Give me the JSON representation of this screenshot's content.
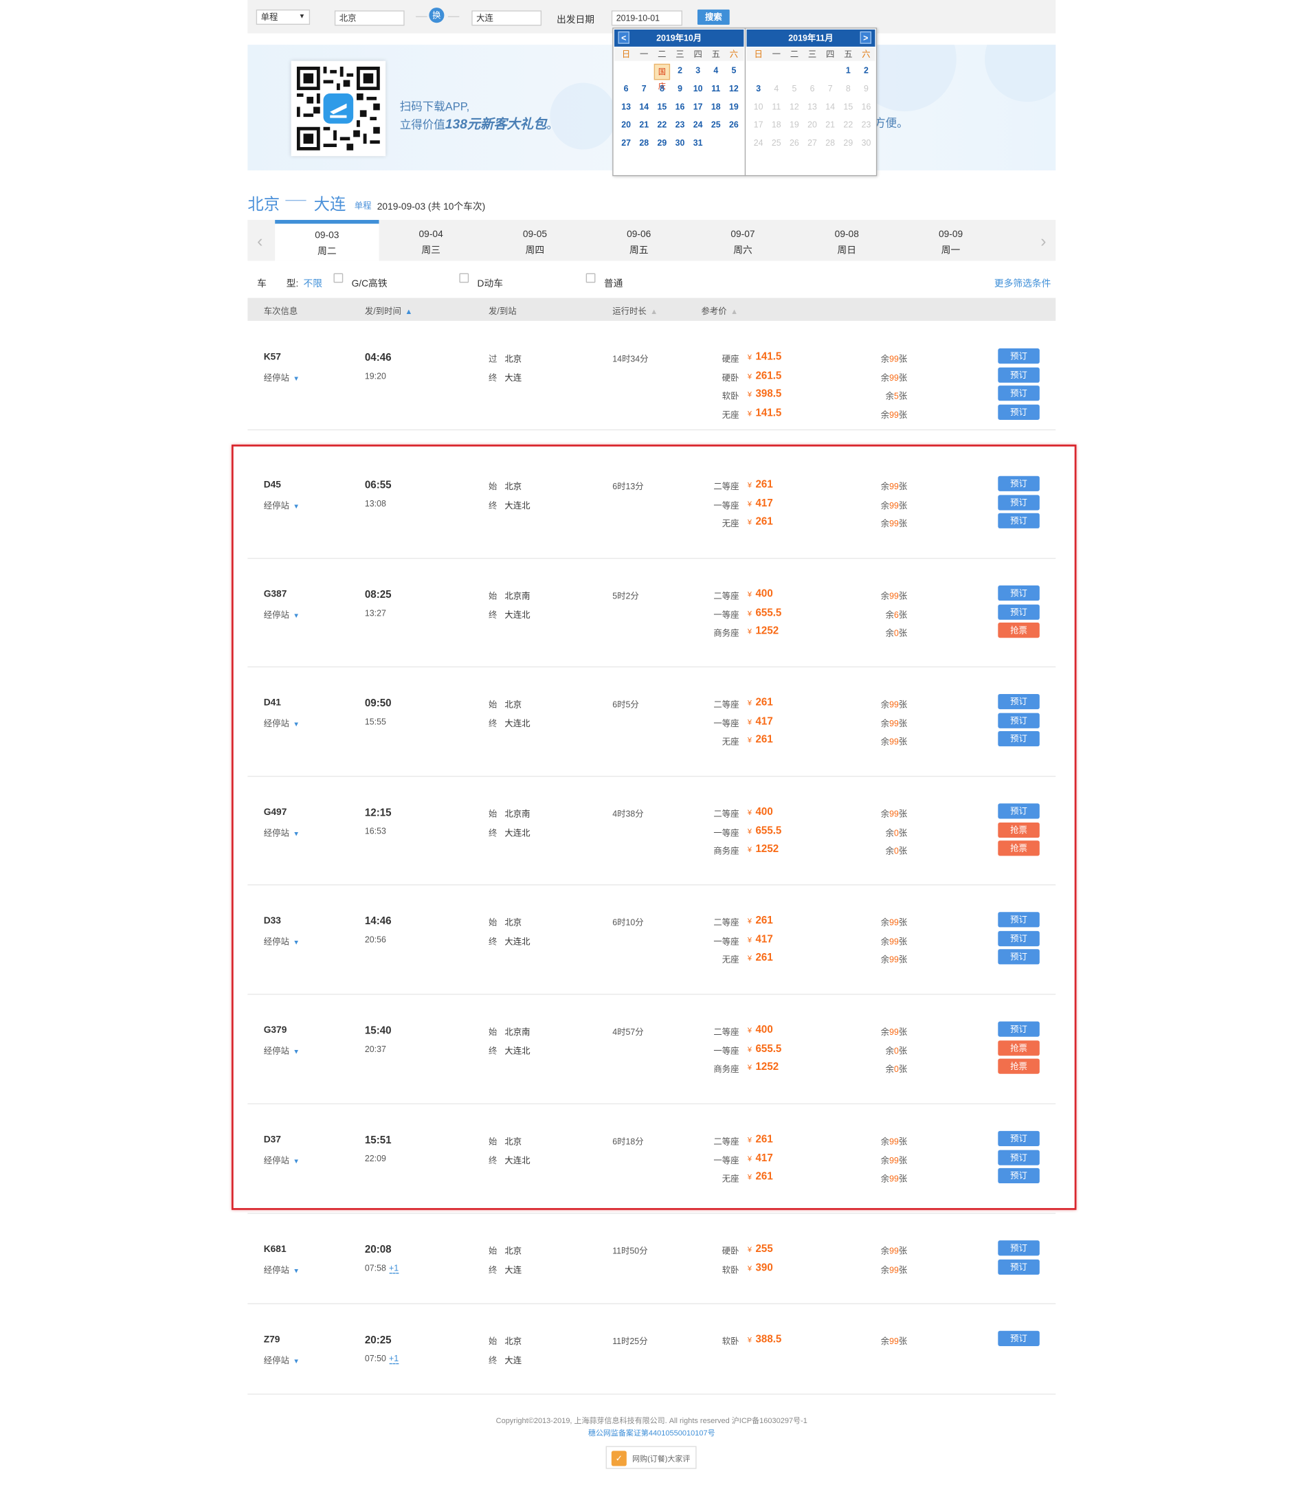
{
  "search": {
    "trip_type": "单程",
    "from": "北京",
    "swap": "换",
    "to": "大连",
    "date_label": "出发日期",
    "date_value": "2019-10-01",
    "search_button": "搜索"
  },
  "banner": {
    "line1": "扫码下载APP,",
    "line2_prefix": "立得价值",
    "line2_highlight": "138元新客大礼包",
    "line2_suffix": "。",
    "tail": "方便。"
  },
  "calendar": {
    "weekdays": [
      "日",
      "一",
      "二",
      "三",
      "四",
      "五",
      "六"
    ],
    "months": [
      {
        "title": "2019年10月",
        "lead": 2,
        "days": [
          "国庆",
          "2",
          "3",
          "4",
          "5",
          "6",
          "7",
          "8",
          "9",
          "10",
          "11",
          "12",
          "13",
          "14",
          "15",
          "16",
          "17",
          "18",
          "19",
          "20",
          "21",
          "22",
          "23",
          "24",
          "25",
          "26",
          "27",
          "28",
          "29",
          "30",
          "31"
        ],
        "enabled_upto": 31
      },
      {
        "title": "2019年11月",
        "lead": 5,
        "days": [
          "1",
          "2",
          "3",
          "4",
          "5",
          "6",
          "7",
          "8",
          "9",
          "10",
          "11",
          "12",
          "13",
          "14",
          "15",
          "16",
          "17",
          "18",
          "19",
          "20",
          "21",
          "22",
          "23",
          "24",
          "25",
          "26",
          "27",
          "28",
          "29",
          "30"
        ],
        "enabled_upto": 3
      }
    ]
  },
  "route": {
    "from": "北京",
    "to": "大连",
    "type": "单程",
    "date_info": "2019-09-03  (共 10个车次)"
  },
  "date_tabs": [
    {
      "date": "09-03",
      "weekday": "周二",
      "active": true
    },
    {
      "date": "09-04",
      "weekday": "周三"
    },
    {
      "date": "09-05",
      "weekday": "周四"
    },
    {
      "date": "09-06",
      "weekday": "周五"
    },
    {
      "date": "09-07",
      "weekday": "周六"
    },
    {
      "date": "09-08",
      "weekday": "周日"
    },
    {
      "date": "09-09",
      "weekday": "周一"
    }
  ],
  "filters": {
    "label_a": "车",
    "label_b": "型:",
    "any": "不限",
    "options": [
      "G/C高铁",
      "D动车",
      "普通"
    ],
    "more": "更多筛选条件"
  },
  "columns": {
    "info": "车次信息",
    "time": "发/到时间",
    "station": "发/到站",
    "duration": "运行时长",
    "price": "参考价"
  },
  "stops_label": "经停站",
  "trains": [
    {
      "code": "K57",
      "dep": "04:46",
      "arr": "19:20",
      "next_day": "",
      "from_tag": "过",
      "from": "北京",
      "to_tag": "终",
      "to": "大连",
      "duration": "14时34分",
      "seats": [
        {
          "name": "硬座",
          "price": "141.5",
          "left_pre": "余",
          "left_n": "99",
          "left_post": "张",
          "btn": "预订",
          "grab": false
        },
        {
          "name": "硬卧",
          "price": "261.5",
          "left_pre": "余",
          "left_n": "99",
          "left_post": "张",
          "btn": "预订",
          "grab": false
        },
        {
          "name": "软卧",
          "price": "398.5",
          "left_pre": "余",
          "left_n": "5",
          "left_post": "张",
          "btn": "预订",
          "grab": false
        },
        {
          "name": "无座",
          "price": "141.5",
          "left_pre": "余",
          "left_n": "99",
          "left_post": "张",
          "btn": "预订",
          "grab": false
        }
      ]
    },
    {
      "code": "D45",
      "dep": "06:55",
      "arr": "13:08",
      "next_day": "",
      "from_tag": "始",
      "from": "北京",
      "to_tag": "终",
      "to": "大连北",
      "duration": "6时13分",
      "seats": [
        {
          "name": "二等座",
          "price": "261",
          "left_pre": "余",
          "left_n": "99",
          "left_post": "张",
          "btn": "预订",
          "grab": false
        },
        {
          "name": "一等座",
          "price": "417",
          "left_pre": "余",
          "left_n": "99",
          "left_post": "张",
          "btn": "预订",
          "grab": false
        },
        {
          "name": "无座",
          "price": "261",
          "left_pre": "余",
          "left_n": "99",
          "left_post": "张",
          "btn": "预订",
          "grab": false
        }
      ]
    },
    {
      "code": "G387",
      "dep": "08:25",
      "arr": "13:27",
      "next_day": "",
      "from_tag": "始",
      "from": "北京南",
      "to_tag": "终",
      "to": "大连北",
      "duration": "5时2分",
      "seats": [
        {
          "name": "二等座",
          "price": "400",
          "left_pre": "余",
          "left_n": "99",
          "left_post": "张",
          "btn": "预订",
          "grab": false
        },
        {
          "name": "一等座",
          "price": "655.5",
          "left_pre": "余",
          "left_n": "6",
          "left_post": "张",
          "btn": "预订",
          "grab": false
        },
        {
          "name": "商务座",
          "price": "1252",
          "left_pre": "余",
          "left_n": "0",
          "left_post": "张",
          "btn": "抢票",
          "grab": true
        }
      ]
    },
    {
      "code": "D41",
      "dep": "09:50",
      "arr": "15:55",
      "next_day": "",
      "from_tag": "始",
      "from": "北京",
      "to_tag": "终",
      "to": "大连北",
      "duration": "6时5分",
      "seats": [
        {
          "name": "二等座",
          "price": "261",
          "left_pre": "余",
          "left_n": "99",
          "left_post": "张",
          "btn": "预订",
          "grab": false
        },
        {
          "name": "一等座",
          "price": "417",
          "left_pre": "余",
          "left_n": "99",
          "left_post": "张",
          "btn": "预订",
          "grab": false
        },
        {
          "name": "无座",
          "price": "261",
          "left_pre": "余",
          "left_n": "99",
          "left_post": "张",
          "btn": "预订",
          "grab": false
        }
      ]
    },
    {
      "code": "G497",
      "dep": "12:15",
      "arr": "16:53",
      "next_day": "",
      "from_tag": "始",
      "from": "北京南",
      "to_tag": "终",
      "to": "大连北",
      "duration": "4时38分",
      "seats": [
        {
          "name": "二等座",
          "price": "400",
          "left_pre": "余",
          "left_n": "99",
          "left_post": "张",
          "btn": "预订",
          "grab": false
        },
        {
          "name": "一等座",
          "price": "655.5",
          "left_pre": "余",
          "left_n": "0",
          "left_post": "张",
          "btn": "抢票",
          "grab": true
        },
        {
          "name": "商务座",
          "price": "1252",
          "left_pre": "余",
          "left_n": "0",
          "left_post": "张",
          "btn": "抢票",
          "grab": true
        }
      ]
    },
    {
      "code": "D33",
      "dep": "14:46",
      "arr": "20:56",
      "next_day": "",
      "from_tag": "始",
      "from": "北京",
      "to_tag": "终",
      "to": "大连北",
      "duration": "6时10分",
      "seats": [
        {
          "name": "二等座",
          "price": "261",
          "left_pre": "余",
          "left_n": "99",
          "left_post": "张",
          "btn": "预订",
          "grab": false
        },
        {
          "name": "一等座",
          "price": "417",
          "left_pre": "余",
          "left_n": "99",
          "left_post": "张",
          "btn": "预订",
          "grab": false
        },
        {
          "name": "无座",
          "price": "261",
          "left_pre": "余",
          "left_n": "99",
          "left_post": "张",
          "btn": "预订",
          "grab": false
        }
      ]
    },
    {
      "code": "G379",
      "dep": "15:40",
      "arr": "20:37",
      "next_day": "",
      "from_tag": "始",
      "from": "北京南",
      "to_tag": "终",
      "to": "大连北",
      "duration": "4时57分",
      "seats": [
        {
          "name": "二等座",
          "price": "400",
          "left_pre": "余",
          "left_n": "99",
          "left_post": "张",
          "btn": "预订",
          "grab": false
        },
        {
          "name": "一等座",
          "price": "655.5",
          "left_pre": "余",
          "left_n": "0",
          "left_post": "张",
          "btn": "抢票",
          "grab": true
        },
        {
          "name": "商务座",
          "price": "1252",
          "left_pre": "余",
          "left_n": "0",
          "left_post": "张",
          "btn": "抢票",
          "grab": true
        }
      ]
    },
    {
      "code": "D37",
      "dep": "15:51",
      "arr": "22:09",
      "next_day": "",
      "from_tag": "始",
      "from": "北京",
      "to_tag": "终",
      "to": "大连北",
      "duration": "6时18分",
      "seats": [
        {
          "name": "二等座",
          "price": "261",
          "left_pre": "余",
          "left_n": "99",
          "left_post": "张",
          "btn": "预订",
          "grab": false
        },
        {
          "name": "一等座",
          "price": "417",
          "left_pre": "余",
          "left_n": "99",
          "left_post": "张",
          "btn": "预订",
          "grab": false
        },
        {
          "name": "无座",
          "price": "261",
          "left_pre": "余",
          "left_n": "99",
          "left_post": "张",
          "btn": "预订",
          "grab": false
        }
      ]
    },
    {
      "code": "K681",
      "dep": "20:08",
      "arr": "07:58",
      "next_day": "+1",
      "from_tag": "始",
      "from": "北京",
      "to_tag": "终",
      "to": "大连",
      "duration": "11时50分",
      "seats": [
        {
          "name": "硬卧",
          "price": "255",
          "left_pre": "余",
          "left_n": "99",
          "left_post": "张",
          "btn": "预订",
          "grab": false
        },
        {
          "name": "软卧",
          "price": "390",
          "left_pre": "余",
          "left_n": "99",
          "left_post": "张",
          "btn": "预订",
          "grab": false
        }
      ]
    },
    {
      "code": "Z79",
      "dep": "20:25",
      "arr": "07:50",
      "next_day": "+1",
      "from_tag": "始",
      "from": "北京",
      "to_tag": "终",
      "to": "大连",
      "duration": "11时25分",
      "seats": [
        {
          "name": "软卧",
          "price": "388.5",
          "left_pre": "余",
          "left_n": "99",
          "left_post": "张",
          "btn": "预订",
          "grab": false
        }
      ]
    }
  ],
  "currency": "¥",
  "footer": {
    "copyright": "Copyright©2013-2019, 上海蒜芽信息科技有限公司. All rights reserved 沪ICP备16030297号-1",
    "beian": "穗公网监备案证第44010550010107号",
    "badge": "网购(订餐)大家评"
  },
  "colors": {
    "accent": "#3f8fd8",
    "book_button": "#4c93e3",
    "grab_button": "#f26f4c",
    "price": "#f86a15",
    "highlight_box": "#d9272e"
  }
}
